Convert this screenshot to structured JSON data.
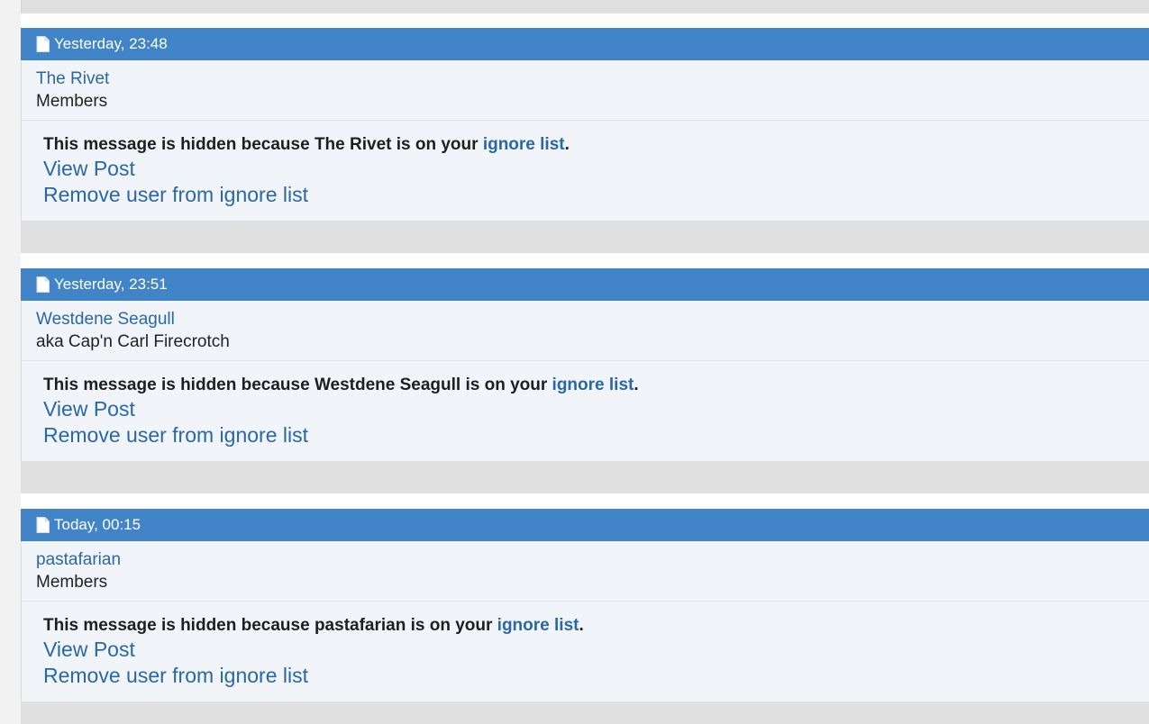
{
  "posts": [
    {
      "date": "Yesterday, 23:48",
      "username": "The Rivet",
      "usertitle": "Members",
      "notice_prefix": "This message is hidden because The Rivet is on your ",
      "ignore_list_link": "ignore list",
      "notice_suffix": ".",
      "view_post": "View Post",
      "remove_user": "Remove user from ignore list"
    },
    {
      "date": "Yesterday, 23:51",
      "username": "Westdene Seagull",
      "usertitle": "aka Cap'n Carl Firecrotch",
      "notice_prefix": "This message is hidden because Westdene Seagull is on your ",
      "ignore_list_link": "ignore list",
      "notice_suffix": ".",
      "view_post": "View Post",
      "remove_user": "Remove user from ignore list"
    },
    {
      "date": "Today, 00:15",
      "username": "pastafarian",
      "usertitle": "Members",
      "notice_prefix": "This message is hidden because pastafarian is on your ",
      "ignore_list_link": "ignore list",
      "notice_suffix": ".",
      "view_post": "View Post",
      "remove_user": "Remove user from ignore list"
    }
  ],
  "colors": {
    "header_blue": "#4284c8",
    "link_blue": "#2a67a5",
    "post_bg": "#f1f5f9",
    "separator_gray": "#e0e0e0"
  },
  "icons": {
    "post_header": "document-icon"
  }
}
